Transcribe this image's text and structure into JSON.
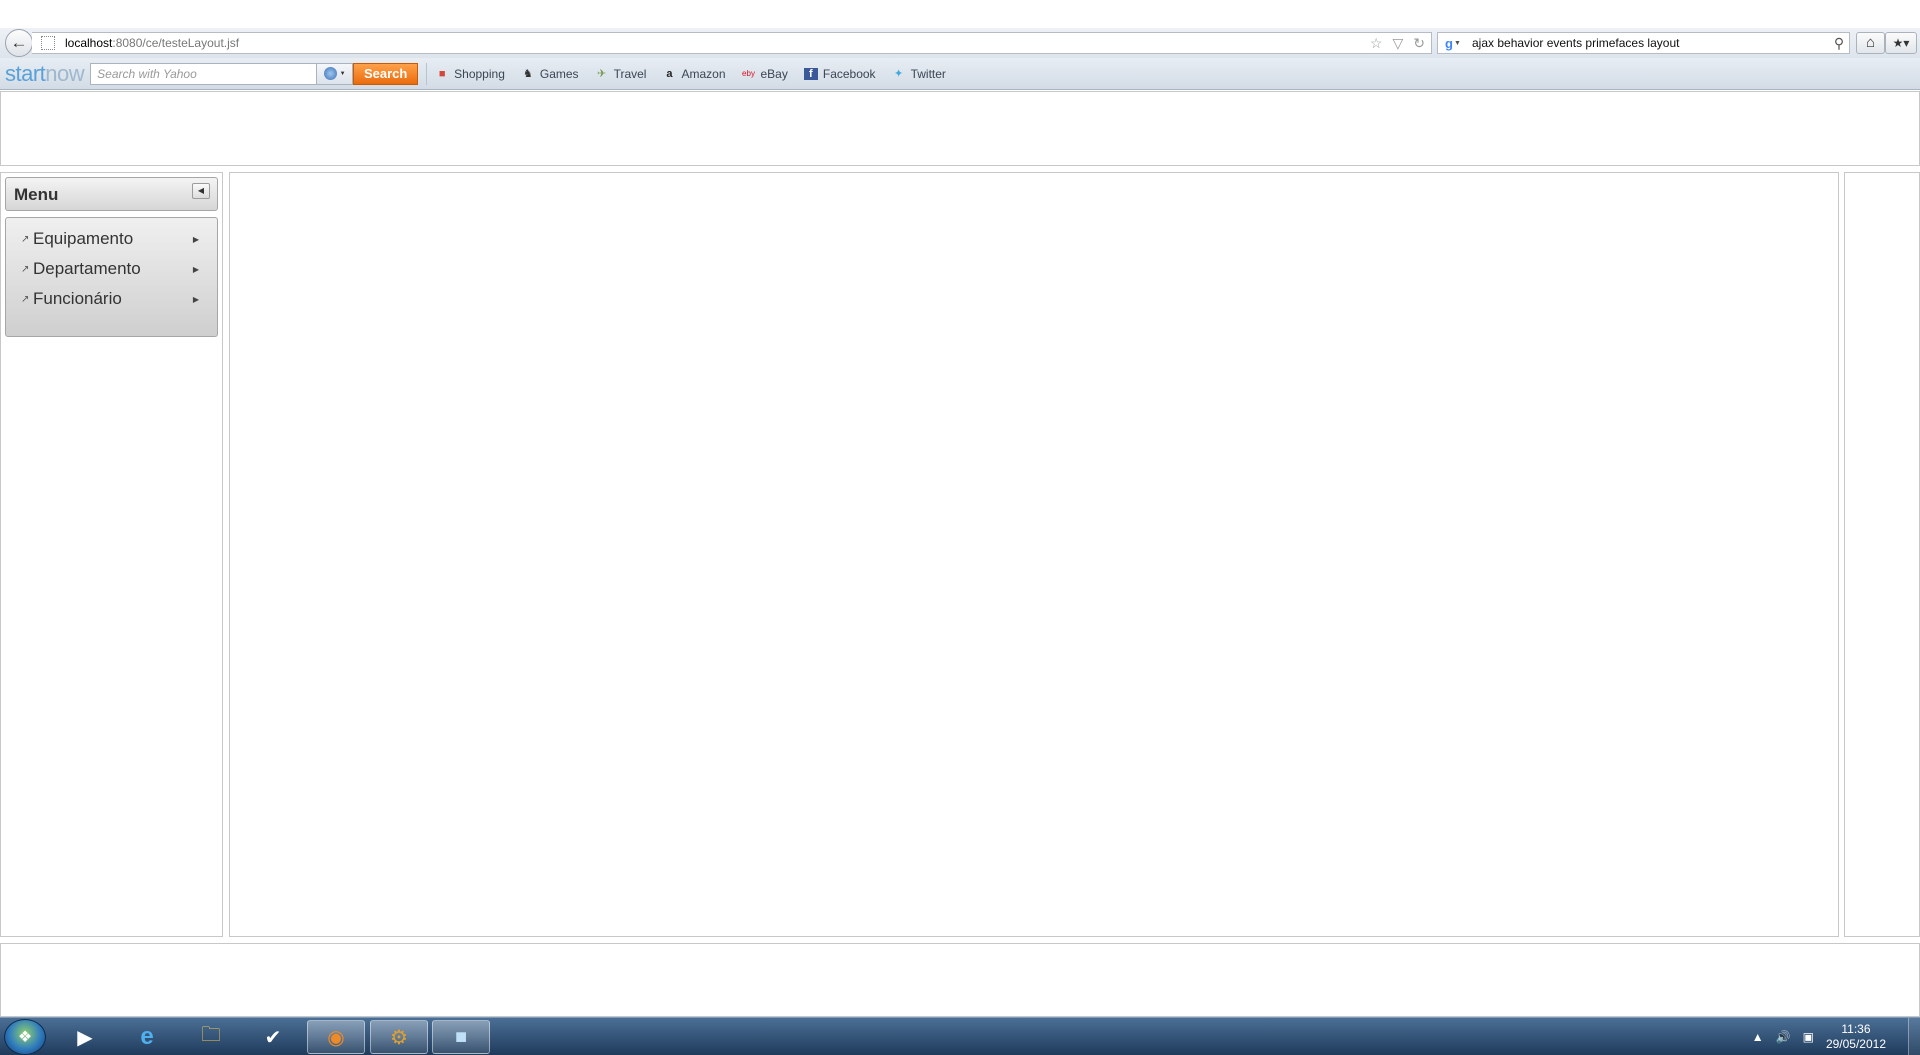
{
  "browser": {
    "url_host": "localhost",
    "url_path": ":8080/ce/testeLayout.jsf",
    "search_query": "ajax behavior events primefaces layout",
    "search_engine_icon": "google-icon"
  },
  "toolbar": {
    "logo_start": "start",
    "logo_now": "now",
    "search_placeholder": "Search with Yahoo",
    "search_button": "Search",
    "links": [
      {
        "label": "Shopping",
        "icon": "shopping-icon"
      },
      {
        "label": "Games",
        "icon": "games-icon"
      },
      {
        "label": "Travel",
        "icon": "travel-icon"
      },
      {
        "label": "Amazon",
        "icon": "amazon-icon"
      },
      {
        "label": "eBay",
        "icon": "ebay-icon"
      },
      {
        "label": "Facebook",
        "icon": "facebook-icon"
      },
      {
        "label": "Twitter",
        "icon": "twitter-icon"
      }
    ]
  },
  "menu": {
    "title": "Menu",
    "items": [
      {
        "label": "Equipamento"
      },
      {
        "label": "Departamento"
      },
      {
        "label": "Funcionário"
      }
    ]
  },
  "taskbar": {
    "apps": [
      "media-player-icon",
      "internet-explorer-icon",
      "file-explorer-icon",
      "task-app-icon",
      "firefox-icon",
      "tools-app-icon",
      "generic-app-icon"
    ],
    "active_app": "firefox-icon",
    "time": "11:36",
    "date": "29/05/2012"
  },
  "colors": {
    "search_button": "#ea6b0d",
    "logo_blue": "#5aa0d8",
    "taskbar": "#1f3b5c"
  }
}
